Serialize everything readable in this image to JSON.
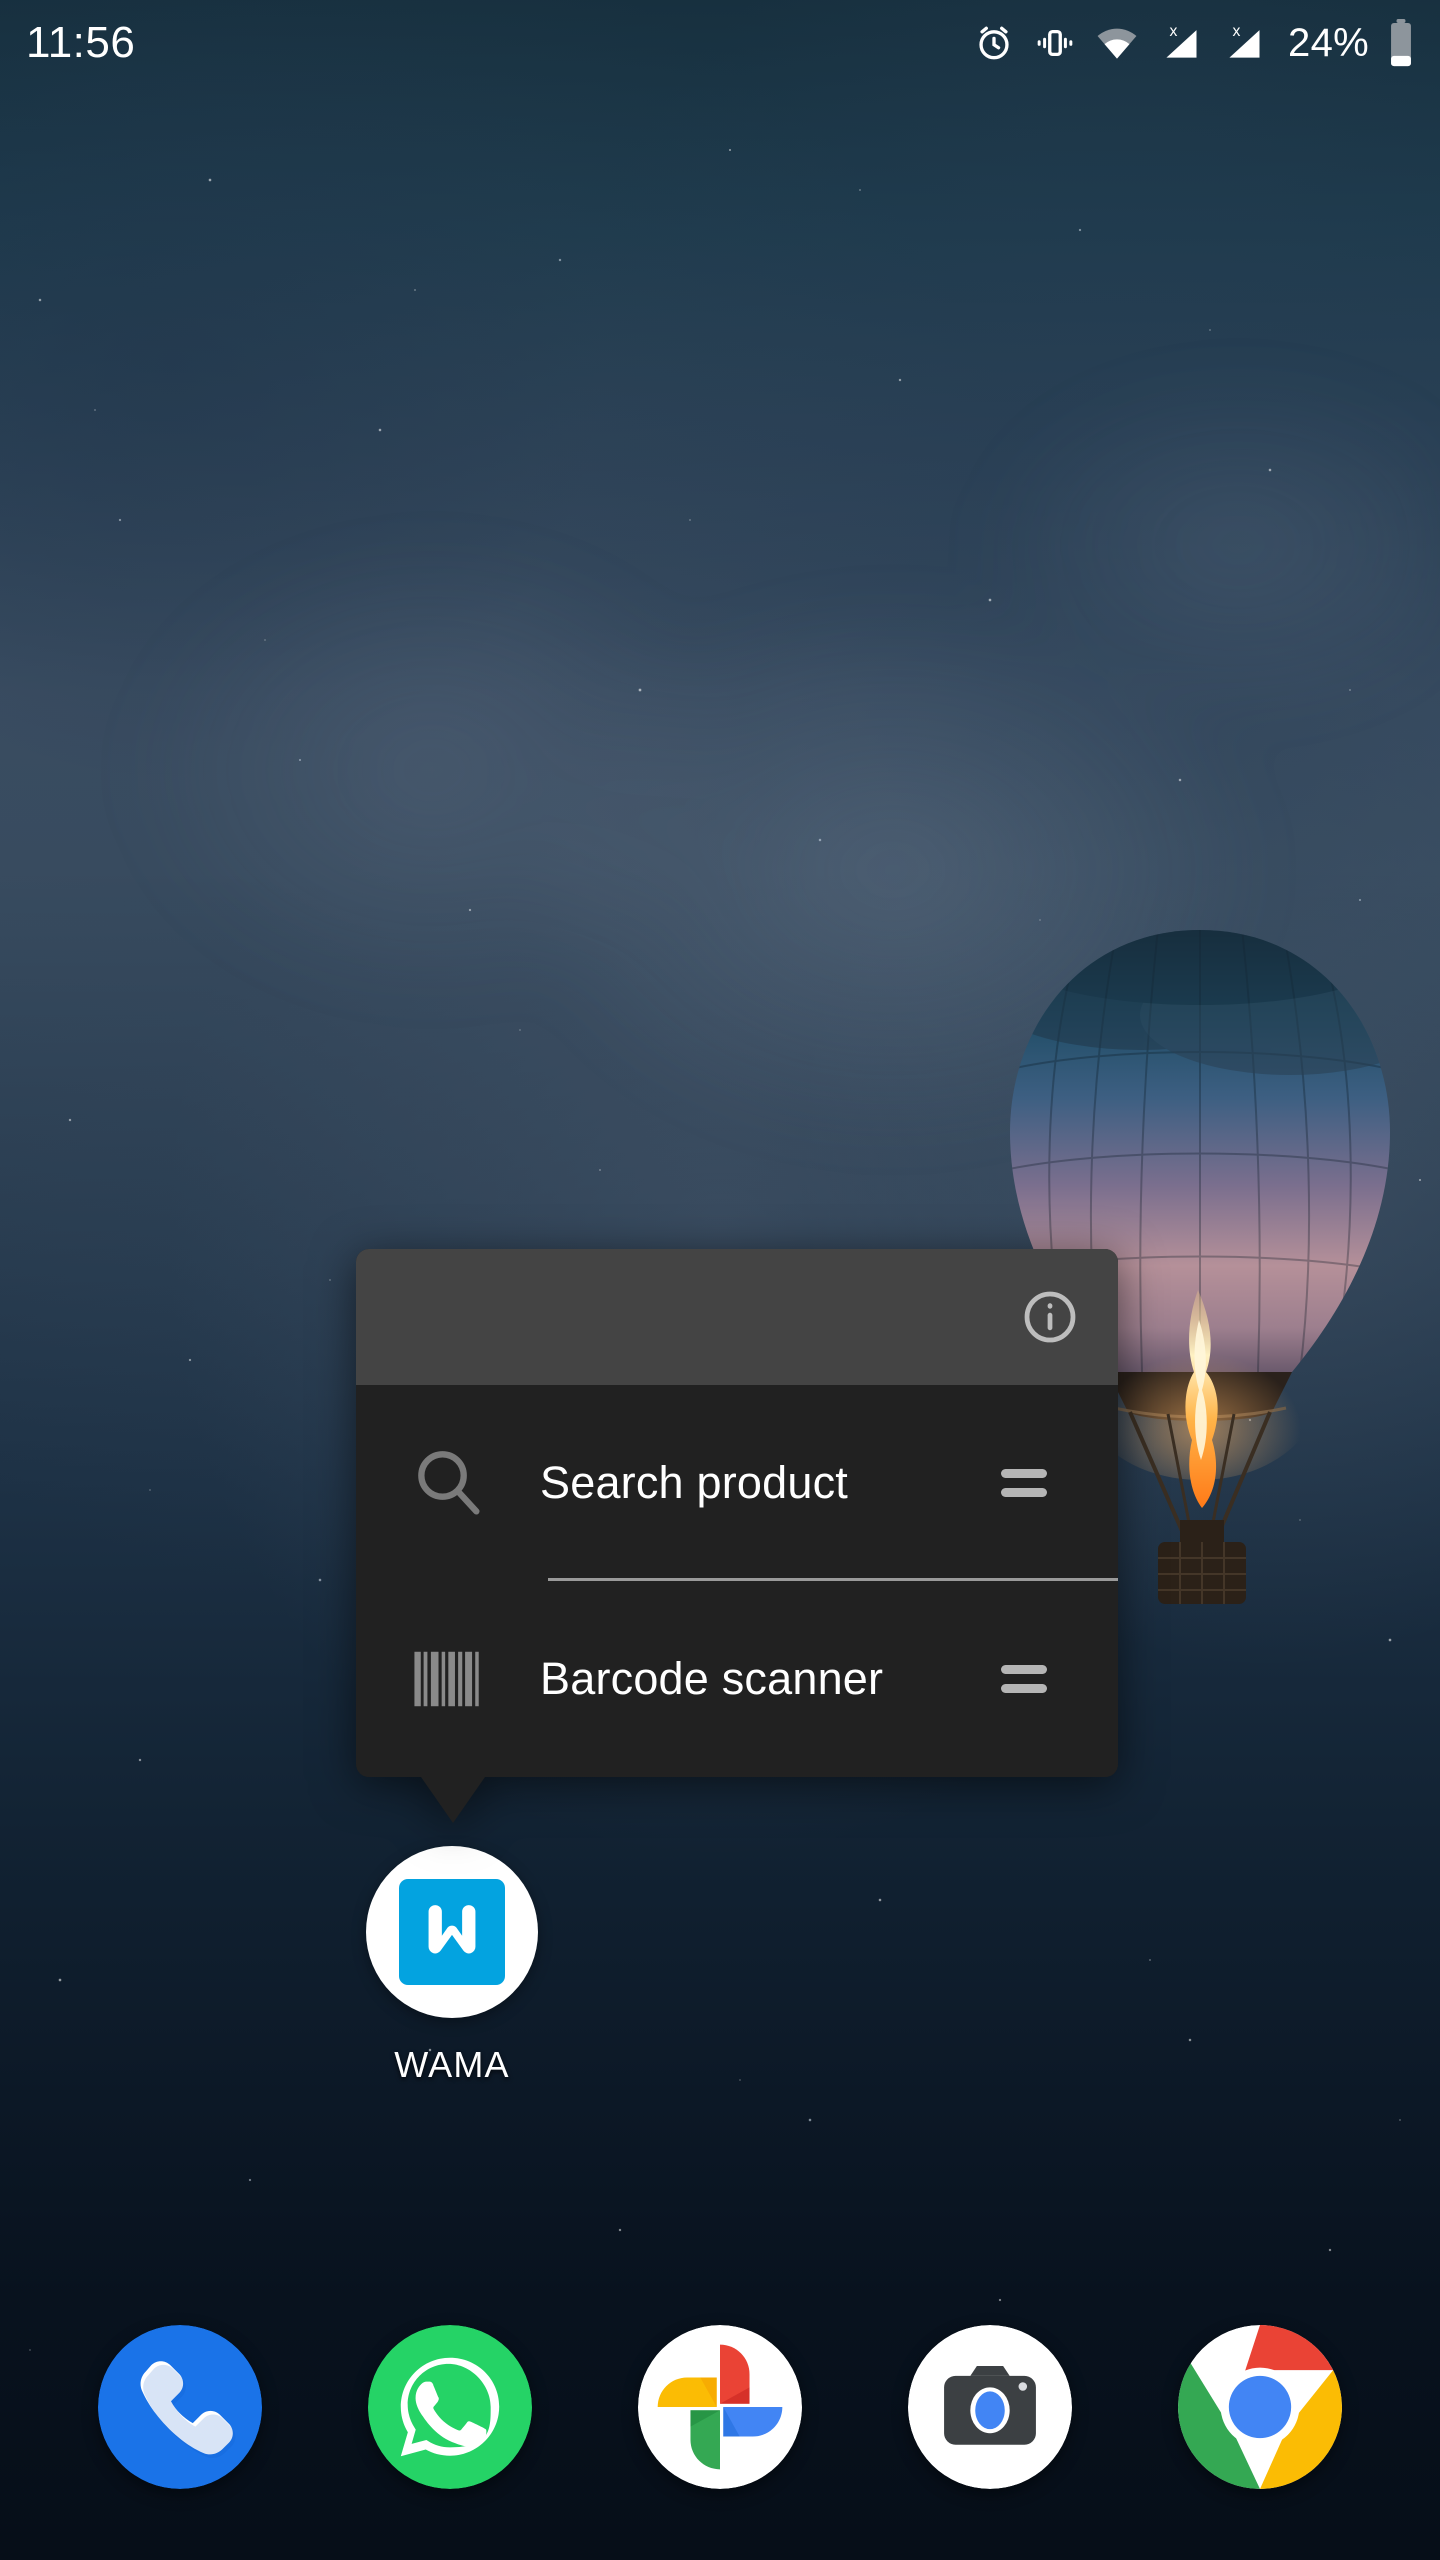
{
  "status_bar": {
    "clock": "11:56",
    "battery_percent": "24%",
    "icons": [
      {
        "name": "alarm-icon",
        "label": "alarm"
      },
      {
        "name": "vibrate-icon",
        "label": "vibrate"
      },
      {
        "name": "wifi-icon",
        "label": "wifi"
      },
      {
        "name": "sim1-no-service-icon",
        "label": "sim 1 no service"
      },
      {
        "name": "sim2-no-service-icon",
        "label": "sim 2 no service"
      },
      {
        "name": "battery-icon",
        "label": "battery"
      }
    ]
  },
  "popup": {
    "info_label": "i",
    "shortcuts": [
      {
        "icon": "search-icon",
        "label": "Search product",
        "handle": "drag-handle-icon"
      },
      {
        "icon": "barcode-icon",
        "label": "Barcode scanner",
        "handle": "drag-handle-icon"
      }
    ]
  },
  "app_icon": {
    "label": "WAMA",
    "glyph": "W",
    "brand_color": "#03a3e0",
    "background_color": "#ffffff"
  },
  "dock": {
    "items": [
      {
        "name": "phone-app-icon",
        "label": "Phone",
        "color": "#1a73e8"
      },
      {
        "name": "whatsapp-app-icon",
        "label": "WhatsApp",
        "color": "#25d366"
      },
      {
        "name": "google-photos-app-icon",
        "label": "Photos",
        "color": "#ffffff"
      },
      {
        "name": "camera-app-icon",
        "label": "Camera",
        "color": "#ffffff"
      },
      {
        "name": "chrome-app-icon",
        "label": "Chrome",
        "color": "#ffffff"
      }
    ]
  },
  "theme": {
    "popup_header_bg": "#444444",
    "popup_body_bg": "#212121",
    "popup_text": "#ffffff",
    "popup_icon": "#7a7a7a",
    "divider": "#9a9a9a"
  }
}
